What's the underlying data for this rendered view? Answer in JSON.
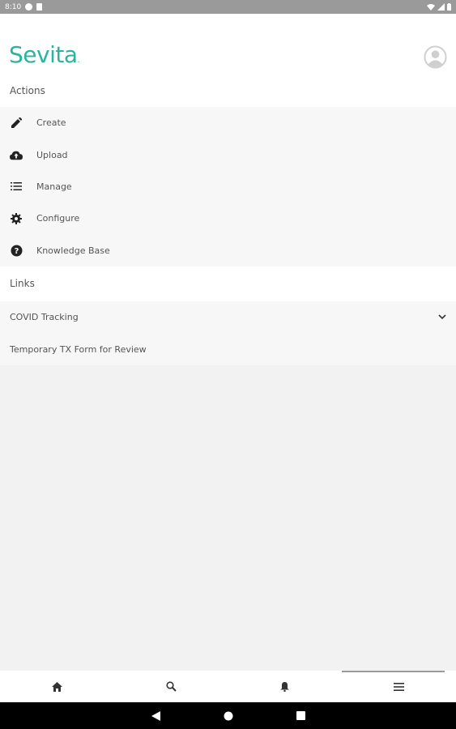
{
  "status_bar": {
    "time": "8:10"
  },
  "header": {
    "logo_text": "Sevita",
    "logo_mark": "."
  },
  "actions": {
    "title": "Actions",
    "items": [
      {
        "label": "Create",
        "icon": "pencil-icon"
      },
      {
        "label": "Upload",
        "icon": "cloud-upload-icon"
      },
      {
        "label": "Manage",
        "icon": "list-icon"
      },
      {
        "label": "Configure",
        "icon": "gear-icon"
      },
      {
        "label": "Knowledge Base",
        "icon": "help-circle-icon"
      }
    ]
  },
  "links": {
    "title": "Links",
    "items": [
      {
        "label": "COVID Tracking",
        "expandable": true
      },
      {
        "label": "Temporary TX Form for Review",
        "expandable": false
      }
    ]
  },
  "bottom_nav": {
    "tabs": [
      {
        "icon": "home-icon",
        "active": false
      },
      {
        "icon": "search-icon",
        "active": false
      },
      {
        "icon": "bell-icon",
        "active": false
      },
      {
        "icon": "menu-icon",
        "active": true
      }
    ]
  },
  "colors": {
    "brand": "#2ab3a1",
    "statusbar": "#9a9a9a"
  }
}
